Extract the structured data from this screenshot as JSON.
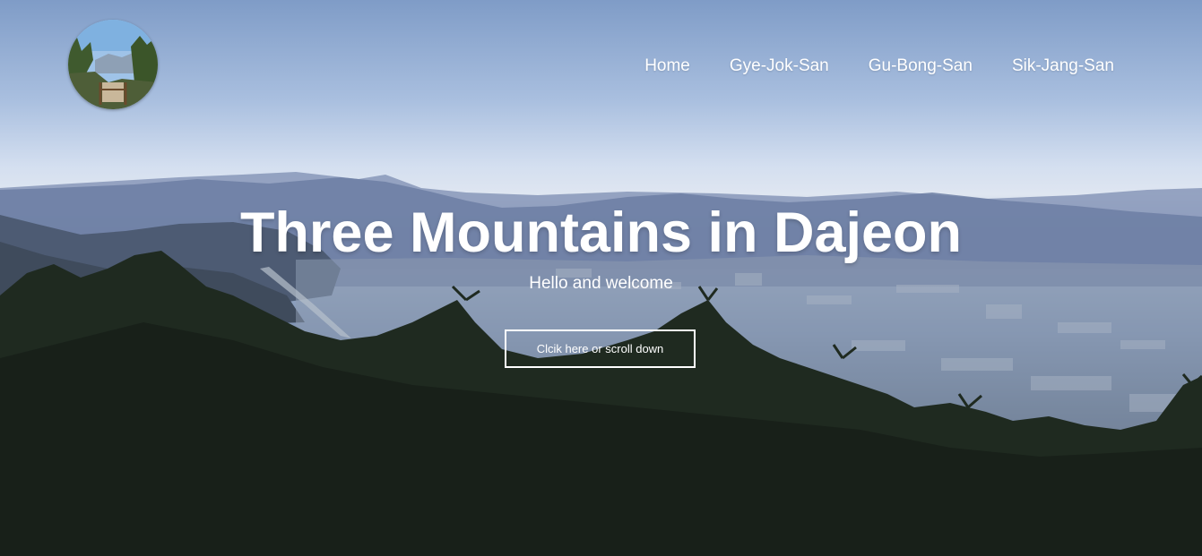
{
  "header": {
    "logo_alt": "mountain trail logo",
    "nav": [
      {
        "label": "Home"
      },
      {
        "label": "Gye-Jok-San"
      },
      {
        "label": "Gu-Bong-San"
      },
      {
        "label": "Sik-Jang-San"
      }
    ]
  },
  "hero": {
    "title": "Three Mountains in Dajeon",
    "subtitle": "Hello and welcome",
    "cta_label": "Clcik here or scroll down"
  },
  "colors": {
    "text": "#ffffff",
    "sky_top": "#7f9cc7",
    "haze": "#dfe6f1",
    "trees": "#1f2a20"
  }
}
